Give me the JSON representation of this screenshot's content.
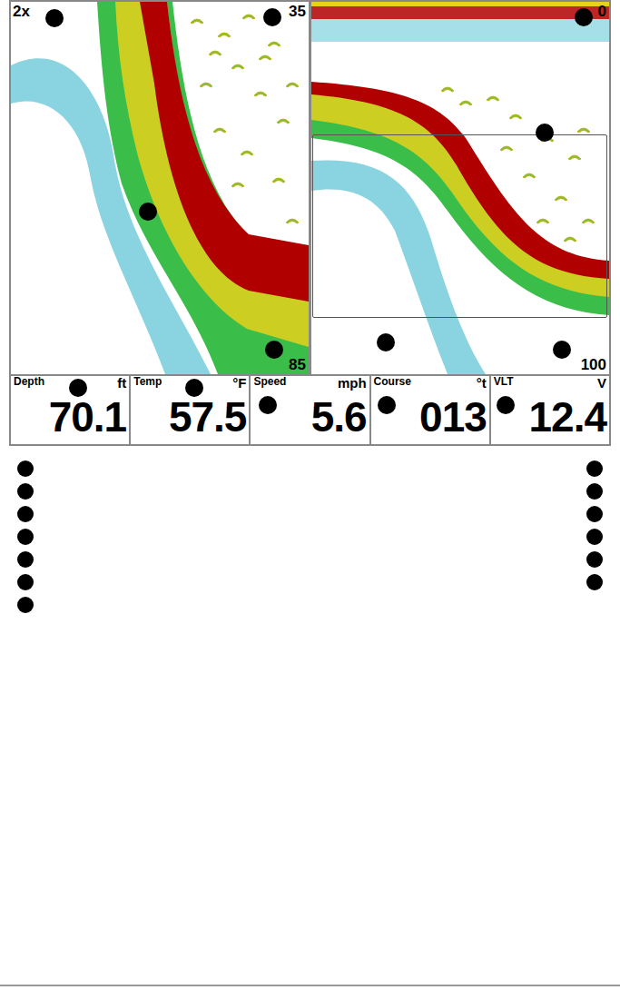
{
  "sonar_views": [
    {
      "name": "zoom",
      "corner_top_left": "2x",
      "top": "35",
      "bottom": "85"
    },
    {
      "name": "full",
      "corner_top_left": "",
      "top": "0",
      "bottom": "100"
    }
  ],
  "readouts": [
    {
      "label": "Depth",
      "unit": "ft",
      "value": "70.1"
    },
    {
      "label": "Temp",
      "unit": "°F",
      "value": "57.5"
    },
    {
      "label": "Speed",
      "unit": "mph",
      "value": "5.6"
    },
    {
      "label": "Course",
      "unit": "°t",
      "value": "013"
    },
    {
      "label": "VLT",
      "unit": "V",
      "value": "12.4"
    }
  ]
}
